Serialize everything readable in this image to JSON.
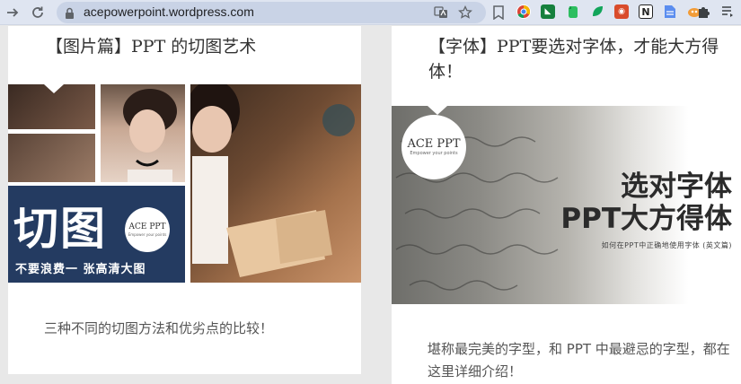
{
  "browser": {
    "url": "acepowerpoint.wordpress.com"
  },
  "posts": [
    {
      "title": "【图片篇】PPT 的切图艺术",
      "excerpt": "三种不同的切图方法和优劣点的比较！",
      "image": {
        "headline": "切图",
        "tagline": "不要浪费一 张高清大图",
        "logo_text": "ACE PPT",
        "logo_sub": "Empower your points"
      }
    },
    {
      "title": "【字体】PPT要选对字体，才能大方得体！",
      "excerpt": "堪称最完美的字型，和 PPT 中最避忌的字型，都在这里详细介绍！",
      "image": {
        "line1": "选对字体",
        "line2": "PPT大方得体",
        "caption": "如何在PPT中正确地使用字体 (英文篇)",
        "logo_text": "ACE PPT",
        "logo_sub": "Empower your points"
      }
    }
  ],
  "colors": {
    "toolbar_bg": "#dfe5f1",
    "omnibox_bg": "#c9d3e6",
    "navy_panel": "#243b61",
    "page_bg": "#e8e8e8"
  }
}
